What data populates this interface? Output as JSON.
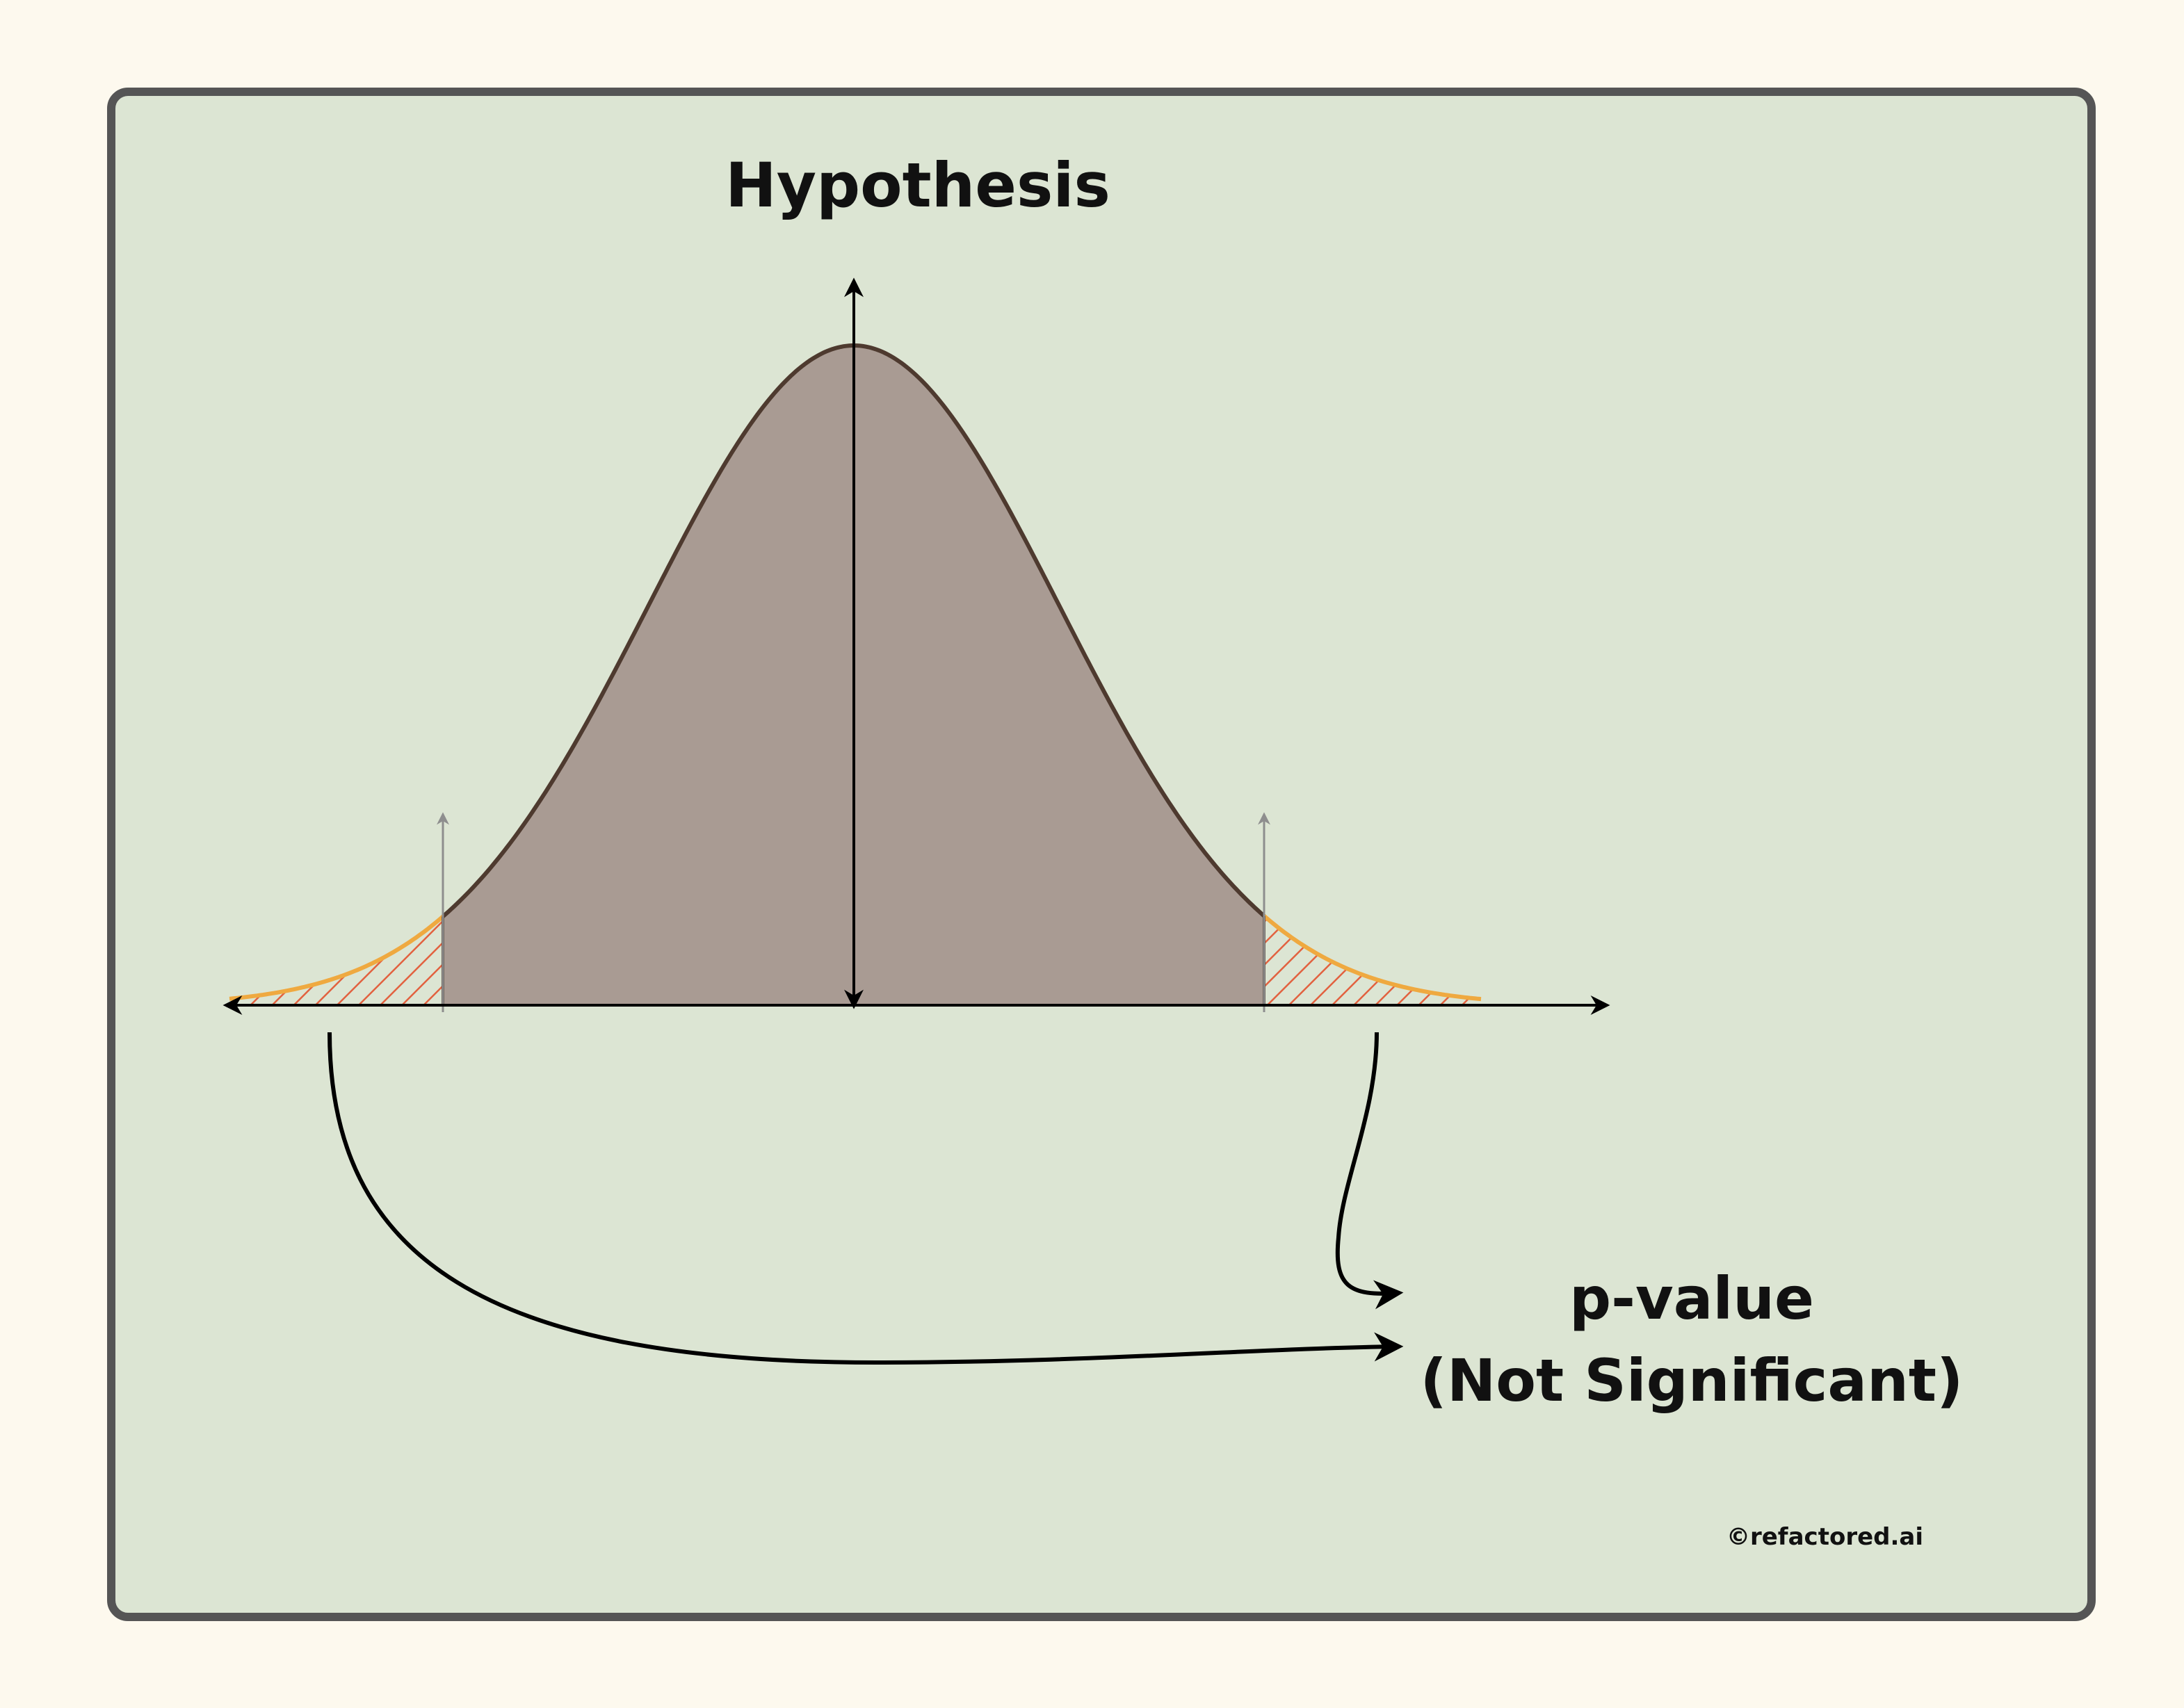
{
  "title": "Hypothesis",
  "result": {
    "line1": "p-value",
    "line2": "(Not Significant)"
  },
  "credit": "©refactored.ai",
  "colors": {
    "page_background": "#fdf9ee",
    "panel_background": "#dce5d3",
    "panel_border": "#555555",
    "curve_fill": "#a99b93",
    "curve_stroke": "#4e3a2f",
    "tail_stroke": "#efa940",
    "tail_hatch": "#e2613f",
    "marker": "#8e8e8e",
    "axis": "#000000"
  },
  "icons": {
    "axis_arrows": "arrow-icon",
    "critical_markers": "up-arrow-icon",
    "connectors": "curved-arrow-icon"
  }
}
